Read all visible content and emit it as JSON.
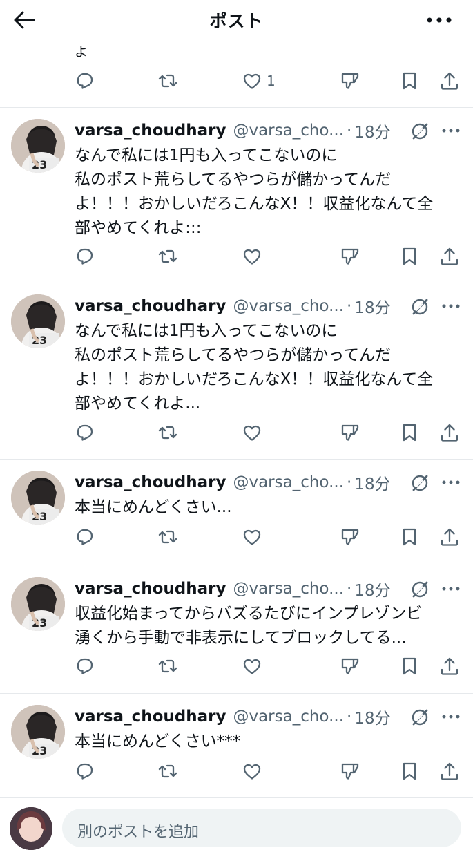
{
  "header": {
    "title": "ポスト"
  },
  "top_post": {
    "text_tail": "よ",
    "like_count": "1"
  },
  "posts": [
    {
      "display_name": "varsa_choudhary",
      "handle": "@varsa_cho...",
      "dot": "·",
      "time": "18分",
      "text": "なんで私には1円も入ってこないのに\n私のポスト荒らしてるやつらが儲かってんだ\nよ！！！おかしいだろこんなX！！収益化なんて全\n部やめてくれよ:::"
    },
    {
      "display_name": "varsa_choudhary",
      "handle": "@varsa_cho...",
      "dot": "·",
      "time": "18分",
      "text": "なんで私には1円も入ってこないのに\n私のポスト荒らしてるやつらが儲かってんだ\nよ！！！おかしいだろこんなX！！収益化なんて全\n部やめてくれよ..."
    },
    {
      "display_name": "varsa_choudhary",
      "handle": "@varsa_cho...",
      "dot": "·",
      "time": "18分",
      "text": "本当にめんどくさい..."
    },
    {
      "display_name": "varsa_choudhary",
      "handle": "@varsa_cho...",
      "dot": "·",
      "time": "18分",
      "text": "収益化始まってからバズるたびにインプレゾンビ\n湧くから手動で非表示にしてブロックしてる..."
    },
    {
      "display_name": "varsa_choudhary",
      "handle": "@varsa_cho...",
      "dot": "·",
      "time": "18分",
      "text": "本当にめんどくさい***"
    }
  ],
  "compose": {
    "placeholder": "別のポストを追加"
  },
  "icons": {
    "back": "arrow-left-icon",
    "more": "more-icon",
    "reply": "reply-icon",
    "retweet": "retweet-icon",
    "like": "heart-icon",
    "dislike": "downvote-icon",
    "bookmark": "bookmark-icon",
    "share": "share-icon",
    "grok": "grok-icon"
  },
  "colors": {
    "text": "#0f1419",
    "muted": "#536471",
    "divider": "#e6e9ec"
  }
}
